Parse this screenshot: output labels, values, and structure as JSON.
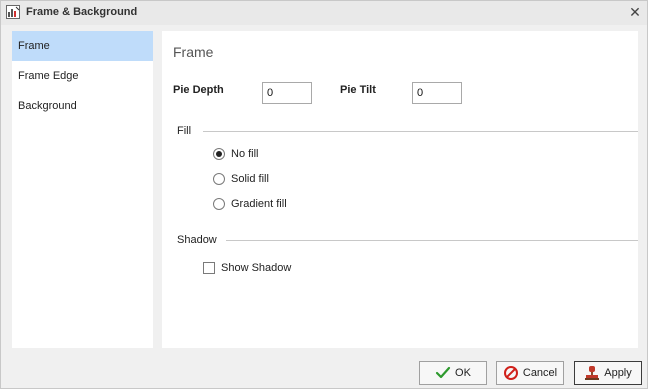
{
  "window": {
    "title": "Frame & Background",
    "close_glyph": "✕"
  },
  "nav": {
    "items": [
      {
        "label": "Frame",
        "selected": true
      },
      {
        "label": "Frame Edge",
        "selected": false
      },
      {
        "label": "Background",
        "selected": false
      }
    ]
  },
  "content": {
    "heading": "Frame",
    "pie_depth": {
      "label": "Pie Depth",
      "value": "0"
    },
    "pie_tilt": {
      "label": "Pie Tilt",
      "value": "0"
    },
    "fill": {
      "group_label": "Fill",
      "options": [
        {
          "label": "No fill",
          "checked": true
        },
        {
          "label": "Solid fill",
          "checked": false
        },
        {
          "label": "Gradient fill",
          "checked": false
        }
      ]
    },
    "shadow": {
      "group_label": "Shadow",
      "show_shadow": {
        "label": "Show Shadow",
        "checked": false
      }
    }
  },
  "buttons": {
    "ok": "OK",
    "cancel": "Cancel",
    "apply": "Apply"
  },
  "colors": {
    "selection": "#bfdcfa",
    "ok_check": "#2e9a2e",
    "cancel_red": "#d0201a"
  }
}
